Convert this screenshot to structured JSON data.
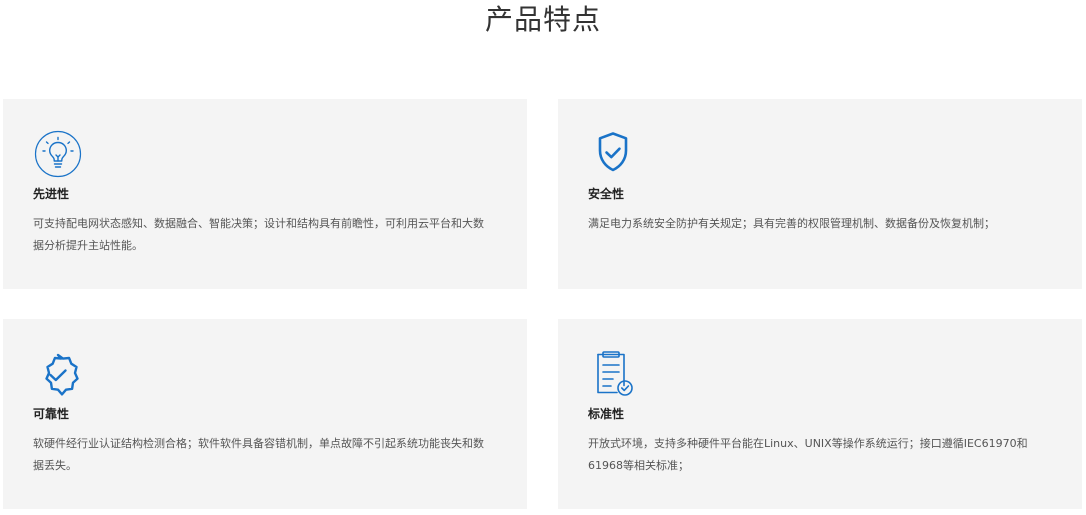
{
  "page": {
    "title": "产品特点",
    "accent_color": "#1a73c8"
  },
  "features": [
    {
      "icon": "lightbulb-icon",
      "title": "先进性",
      "description": "可支持配电网状态感知、数据融合、智能决策；设计和结构具有前瞻性，可利用云平台和大数据分析提升主站性能。"
    },
    {
      "icon": "shield-check-icon",
      "title": "安全性",
      "description": "满足电力系统安全防护有关规定；具有完善的权限管理机制、数据备份及恢复机制；"
    },
    {
      "icon": "badge-check-icon",
      "title": "可靠性",
      "description": "软硬件经行业认证结构检测合格；软件软件具备容错机制，单点故障不引起系统功能丧失和数据丢失。"
    },
    {
      "icon": "clipboard-check-icon",
      "title": "标准性",
      "description": "开放式环境，支持多种硬件平台能在Linux、UNIX等操作系统运行；接口遵循IEC61970和61968等相关标准；"
    }
  ]
}
